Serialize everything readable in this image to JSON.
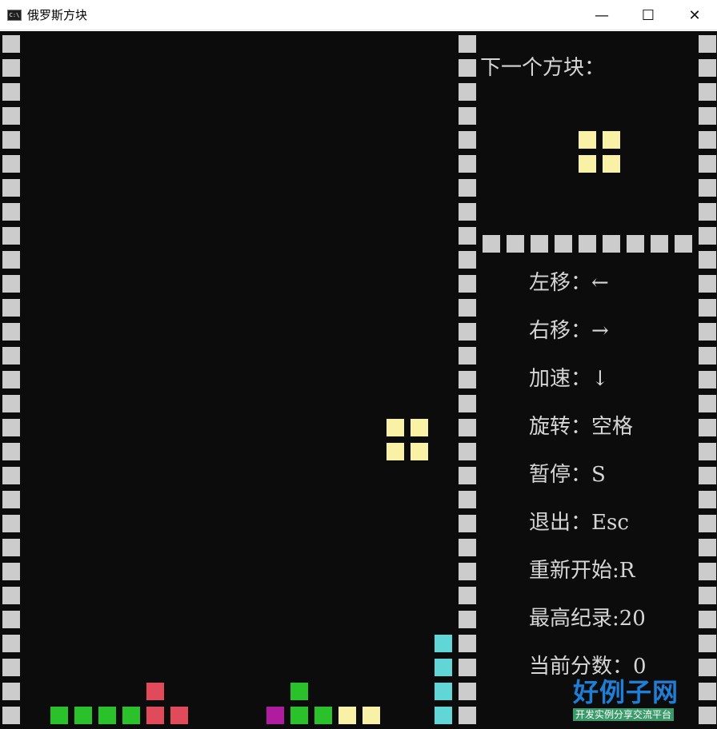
{
  "window": {
    "title": "俄罗斯方块",
    "icon": "console-icon",
    "controls": {
      "minimize": "—",
      "maximize": "☐",
      "close": "✕"
    }
  },
  "board": {
    "wall_color": "#cccccc",
    "background_color": "#0c0c0c",
    "stack": [
      {
        "row": 27,
        "col": 6,
        "color": "#e04a5a"
      },
      {
        "row": 27,
        "col": 12,
        "color": "#2ac12a"
      },
      {
        "row": 28,
        "col": 2,
        "color": "#2ac12a"
      },
      {
        "row": 28,
        "col": 3,
        "color": "#2ac12a"
      },
      {
        "row": 28,
        "col": 4,
        "color": "#2ac12a"
      },
      {
        "row": 28,
        "col": 5,
        "color": "#2ac12a"
      },
      {
        "row": 28,
        "col": 6,
        "color": "#e04a5a"
      },
      {
        "row": 28,
        "col": 7,
        "color": "#e04a5a"
      },
      {
        "row": 28,
        "col": 11,
        "color": "#b01ca0"
      },
      {
        "row": 28,
        "col": 12,
        "color": "#2ac12a"
      },
      {
        "row": 28,
        "col": 13,
        "color": "#2ac12a"
      },
      {
        "row": 28,
        "col": 14,
        "color": "#f9f1a5"
      },
      {
        "row": 28,
        "col": 15,
        "color": "#f9f1a5"
      },
      {
        "row": 29,
        "col": 1,
        "color": "#2ac12a"
      },
      {
        "row": 29,
        "col": 2,
        "color": "#2ac12a"
      },
      {
        "row": 29,
        "col": 3,
        "color": "#2ac12a"
      },
      {
        "row": 29,
        "col": 4,
        "color": "#2ac12a"
      },
      {
        "row": 29,
        "col": 5,
        "color": "#e04a5a"
      },
      {
        "row": 29,
        "col": 6,
        "color": "#e04a5a"
      },
      {
        "row": 29,
        "col": 7,
        "color": "#e04a5a"
      },
      {
        "row": 29,
        "col": 8,
        "color": "#e04a5a"
      },
      {
        "row": 29,
        "col": 9,
        "color": "#e04a5a"
      },
      {
        "row": 29,
        "col": 10,
        "color": "#b01ca0"
      },
      {
        "row": 29,
        "col": 11,
        "color": "#b01ca0"
      },
      {
        "row": 29,
        "col": 12,
        "color": "#b01ca0"
      },
      {
        "row": 29,
        "col": 13,
        "color": "#2ac12a"
      },
      {
        "row": 29,
        "col": 14,
        "color": "#f9f1a5"
      },
      {
        "row": 29,
        "col": 15,
        "color": "#f9f1a5"
      },
      {
        "row": 25,
        "col": 18,
        "color": "#61d6d6"
      },
      {
        "row": 26,
        "col": 18,
        "color": "#61d6d6"
      },
      {
        "row": 27,
        "col": 18,
        "color": "#61d6d6"
      },
      {
        "row": 28,
        "col": 18,
        "color": "#61d6d6"
      }
    ],
    "falling_piece": {
      "color": "#f9f1a5",
      "cells": [
        {
          "row": 16,
          "col": 16
        },
        {
          "row": 16,
          "col": 17
        },
        {
          "row": 17,
          "col": 16
        },
        {
          "row": 17,
          "col": 17
        }
      ]
    }
  },
  "next_piece": {
    "label": "下一个方块：",
    "color": "#f9f1a5",
    "cells": [
      {
        "row": 4,
        "col": 24
      },
      {
        "row": 4,
        "col": 25
      },
      {
        "row": 5,
        "col": 24
      },
      {
        "row": 5,
        "col": 25
      }
    ]
  },
  "controls_help": [
    "左移：←",
    "右移：→",
    "加速：↓",
    "旋转：空格",
    "暂停：S",
    "退出：Esc",
    "重新开始:R",
    "最高纪录:20",
    "当前分数：0"
  ],
  "watermark": {
    "big": "好例子网",
    "small": "开发实例分享交流平台"
  }
}
